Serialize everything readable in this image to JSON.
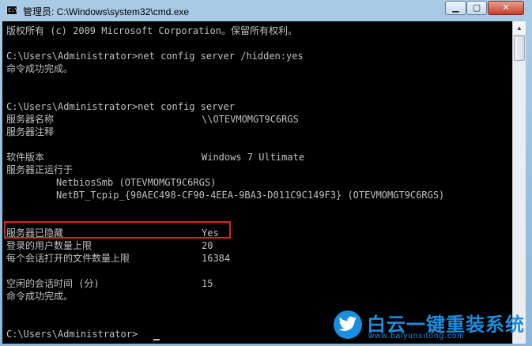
{
  "window": {
    "title": "管理员: C:\\Windows\\system32\\cmd.exe",
    "icon_name": "cmd-icon",
    "buttons": {
      "minimize": "minimize-icon",
      "maximize": "maximize-icon",
      "close": "close-icon"
    }
  },
  "console": {
    "lines": [
      "版权所有 (c) 2009 Microsoft Corporation。保留所有权利。",
      "C:\\Users\\Administrator>net config server /hidden:yes",
      "命令成功完成。",
      "C:\\Users\\Administrator>net config server",
      "服务器名称",
      "服务器注释",
      "软件版本",
      "服务器正运行于",
      "NetbiosSmb (OTEVMOMGT9C6RGS)",
      "NetBT_Tcpip_{90AEC498-CF90-4EEA-9BA3-D011C9C149F3} (OTEVMOMGT9C6RGS)",
      "服务器已隐藏",
      "登录的用户数量上限",
      "每个会话打开的文件数量上限",
      "空闲的会话时间 (分)",
      "命令成功完成。",
      "C:\\Users\\Administrator>"
    ],
    "values": {
      "server_name": "\\\\OTEVMOMGT9C6RGS",
      "software_version": "Windows 7 Ultimate",
      "server_hidden": "Yes",
      "max_users": "20",
      "max_open_files": "16384",
      "idle_time": "15"
    }
  },
  "highlight_color": "#e0202a",
  "watermark": {
    "text": "白云一键重装系统",
    "url": "www.baiyunxitong.com",
    "color": "#1a8ee0",
    "icon": "twitter-bird-icon"
  }
}
